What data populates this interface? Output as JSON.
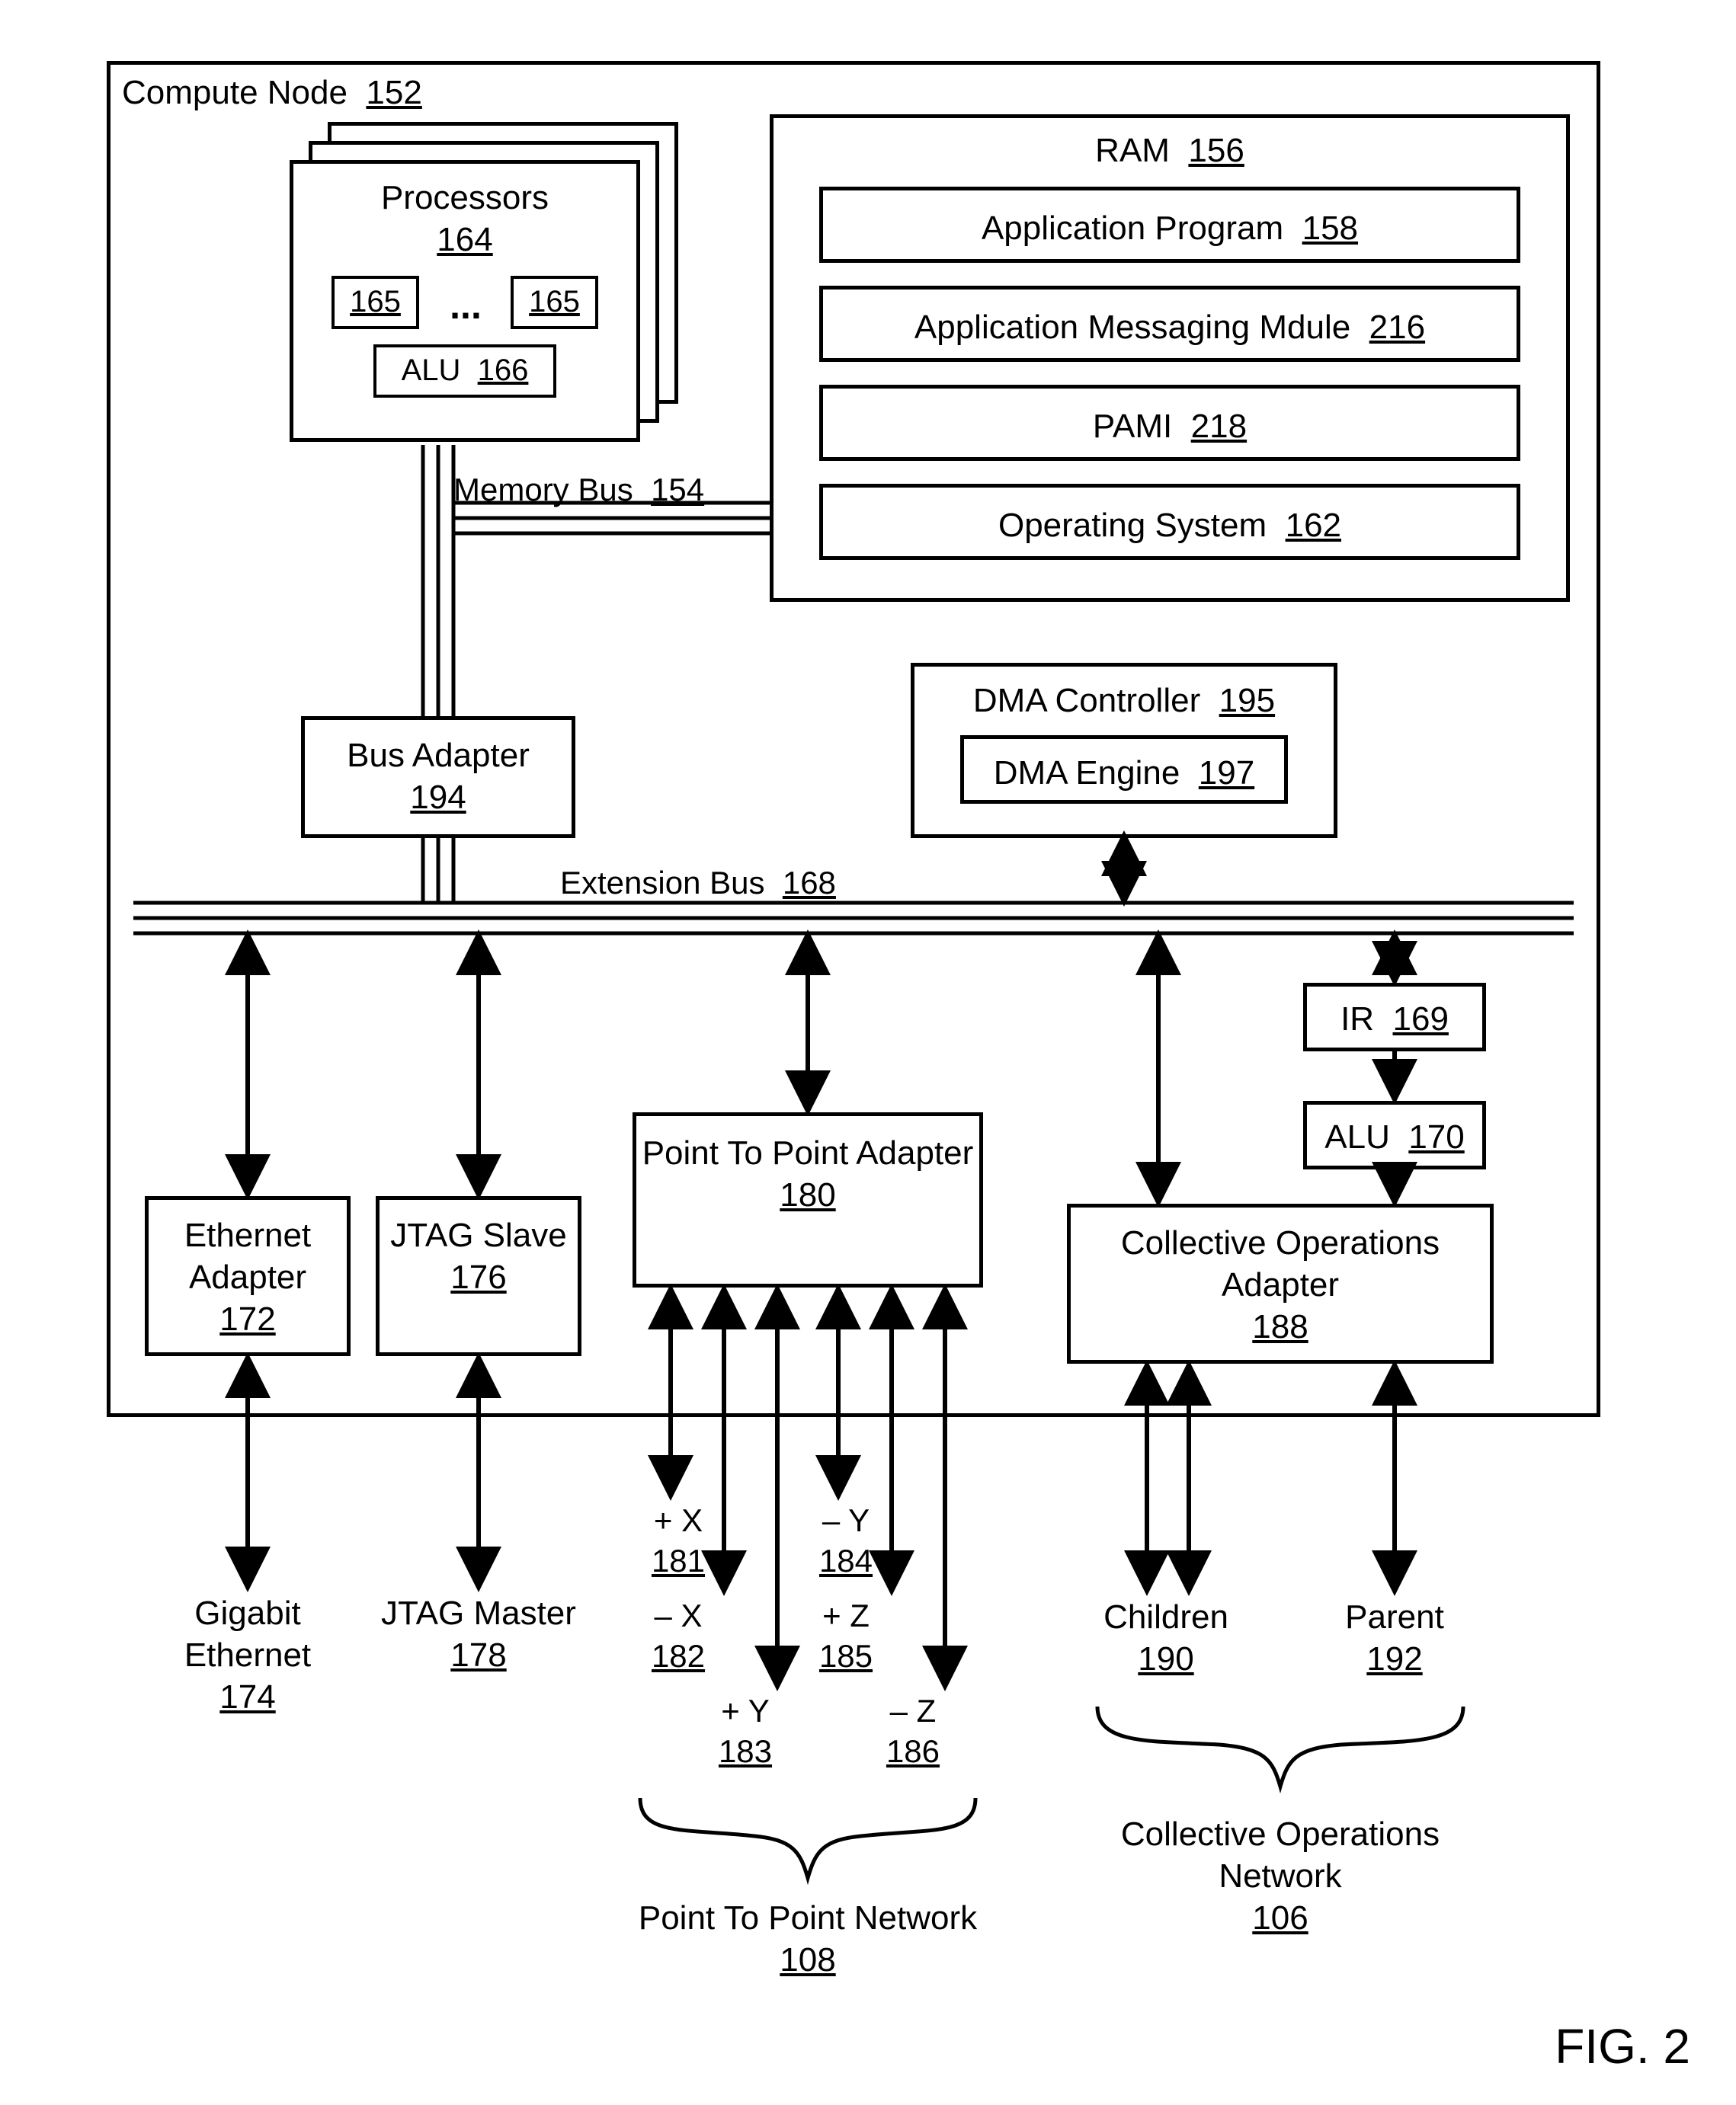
{
  "figure": "FIG. 2",
  "computeNode": {
    "label": "Compute Node",
    "num": "152"
  },
  "processors": {
    "label": "Processors",
    "num": "164",
    "core": "165",
    "alu": "ALU",
    "aluNum": "166"
  },
  "ram": {
    "label": "RAM",
    "num": "156",
    "app": {
      "label": "Application Program",
      "num": "158"
    },
    "msg": {
      "label": "Application Messaging Mdule",
      "num": "216"
    },
    "pami": {
      "label": "PAMI",
      "num": "218"
    },
    "os": {
      "label": "Operating System",
      "num": "162"
    }
  },
  "memoryBus": {
    "label": "Memory Bus",
    "num": "154"
  },
  "busAdapter": {
    "label": "Bus Adapter",
    "num": "194"
  },
  "extensionBus": {
    "label": "Extension Bus",
    "num": "168"
  },
  "dma": {
    "label": "DMA Controller",
    "num": "195",
    "engine": {
      "label": "DMA Engine",
      "num": "197"
    }
  },
  "ir": {
    "label": "IR",
    "num": "169"
  },
  "alu2": {
    "label": "ALU",
    "num": "170"
  },
  "ethernet": {
    "label": "Ethernet Adapter",
    "num": "172"
  },
  "jtagSlave": {
    "label": "JTAG Slave",
    "num": "176"
  },
  "p2p": {
    "label": "Point To Point Adapter",
    "num": "180"
  },
  "collective": {
    "label": "Collective Operations Adapter",
    "num": "188"
  },
  "axes": {
    "px": {
      "label": "+ X",
      "num": "181"
    },
    "mx": {
      "label": "– X",
      "num": "182"
    },
    "py": {
      "label": "+ Y",
      "num": "183"
    },
    "my": {
      "label": "– Y",
      "num": "184"
    },
    "pz": {
      "label": "+ Z",
      "num": "185"
    },
    "mz": {
      "label": "– Z",
      "num": "186"
    }
  },
  "children": {
    "label": "Children",
    "num": "190"
  },
  "parent": {
    "label": "Parent",
    "num": "192"
  },
  "gigabit": {
    "label": "Gigabit Ethernet",
    "num": "174"
  },
  "jtagMaster": {
    "label": "JTAG Master",
    "num": "178"
  },
  "p2pNet": {
    "label": "Point To Point Network",
    "num": "108"
  },
  "collNet": {
    "label": "Collective Operations Network",
    "num": "106"
  }
}
